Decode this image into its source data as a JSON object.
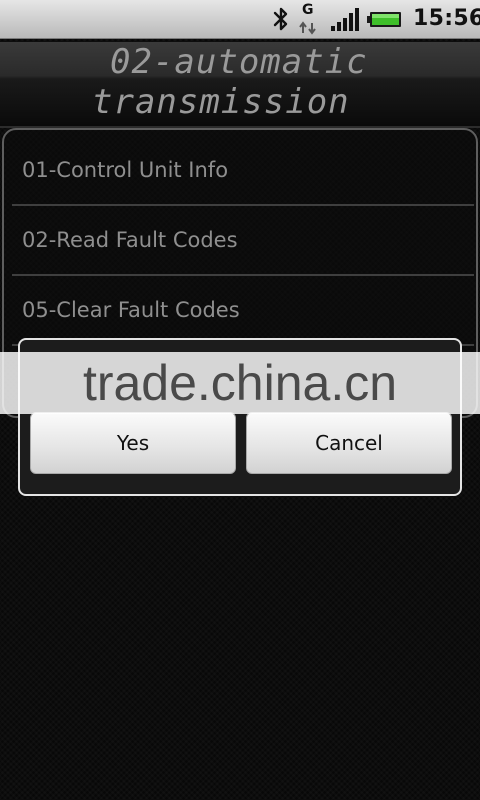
{
  "status_bar": {
    "time": "15:56",
    "network_letter": "G",
    "icons": [
      "bluetooth-icon",
      "gprs-data-icon",
      "signal-strength-icon",
      "battery-icon"
    ]
  },
  "header": {
    "title_line1": "02-automatic",
    "title_line2": "transmission"
  },
  "menu": {
    "items": [
      {
        "label": "01-Control Unit Info"
      },
      {
        "label": "02-Read Fault Codes"
      },
      {
        "label": "05-Clear Fault Codes"
      }
    ]
  },
  "dialog": {
    "yes_label": "Yes",
    "cancel_label": "Cancel"
  },
  "watermark": {
    "text": "trade.china.cn"
  },
  "colors": {
    "status_bar_bg": "#d4d4d4",
    "battery_fill": "#3fbf2a",
    "title_text": "#9a9a9a",
    "list_text": "#8f8f8f",
    "dialog_border": "#e4e4e4"
  }
}
